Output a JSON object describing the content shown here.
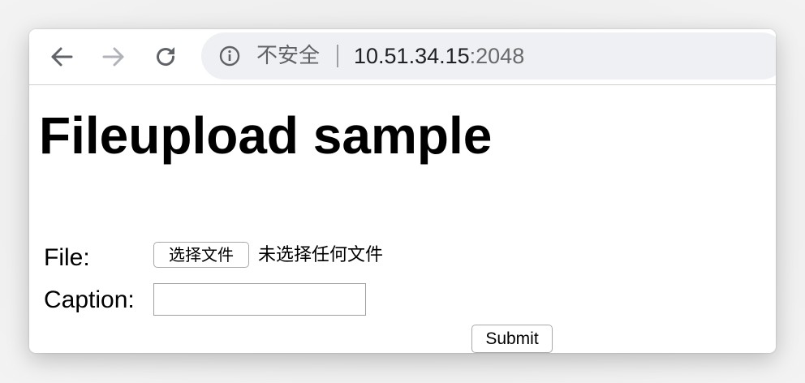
{
  "browser": {
    "nav": {
      "back_icon": "arrow-left-icon",
      "forward_icon": "arrow-right-icon",
      "reload_icon": "reload-icon"
    },
    "omnibox": {
      "info_icon": "info-circle-icon",
      "security_label": "不安全",
      "url_host": "10.51.34.15",
      "url_port": ":2048"
    }
  },
  "page": {
    "title": "Fileupload sample",
    "form": {
      "file_label": "File:",
      "choose_file_button": "选择文件",
      "no_file_text": "未选择任何文件",
      "caption_label": "Caption:",
      "caption_value": "",
      "submit_label": "Submit"
    }
  },
  "colors": {
    "omnibox_bg": "#eef0f3",
    "icon_active": "#5f6368",
    "icon_disabled": "#b0b3b8"
  }
}
